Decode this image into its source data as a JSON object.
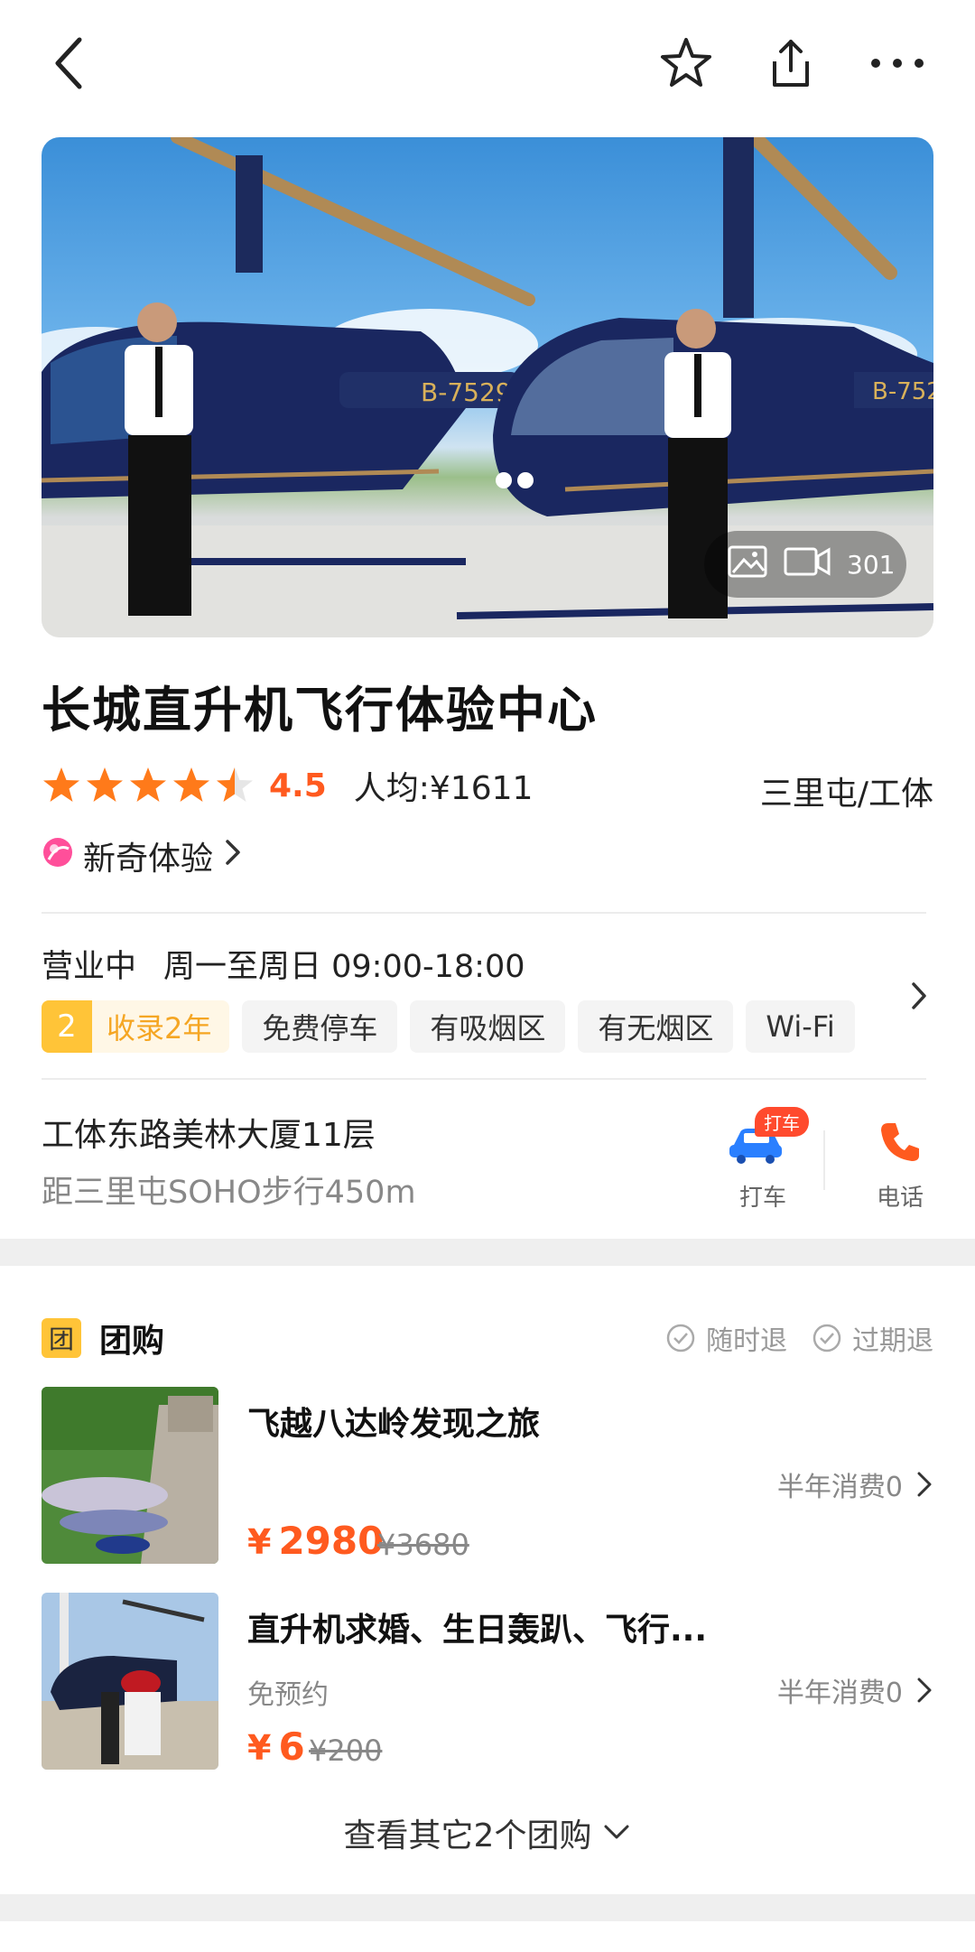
{
  "header": {
    "back_icon": "chevron-left-icon",
    "favorite_icon": "star-outline-icon",
    "share_icon": "share-icon",
    "more_icon": "more-dots-icon"
  },
  "hero": {
    "media_count": "301",
    "image_description_icons": [
      "image-icon",
      "video-icon"
    ]
  },
  "shop": {
    "name": "长城直升机飞行体验中心",
    "rating": 4.5,
    "rating_text": "4.5",
    "avg_price": "人均:¥1611",
    "area": "三里屯/工体",
    "category": "新奇体验",
    "hours_status": "营业中",
    "hours_text": "周一至周日 09:00-18:00",
    "record_years_num": "2",
    "record_years_text": "收录2年",
    "tags": [
      "免费停车",
      "有吸烟区",
      "有无烟区",
      "Wi-Fi"
    ],
    "address": "工体东路美林大厦11层",
    "distance": "距三里屯SOHO步行450m",
    "taxi_badge": "打车",
    "taxi_label": "打车",
    "phone_label": "电话"
  },
  "group_buy": {
    "badge": "团",
    "title": "团购",
    "refund_anytime": "随时退",
    "refund_expired": "过期退",
    "deals": [
      {
        "name": "飞越八达岭发现之旅",
        "sub": "",
        "consume": "半年消费0",
        "currency": "¥",
        "price": "2980",
        "original": "¥3680"
      },
      {
        "name": "直升机求婚、生日轰趴、飞行...",
        "sub": "免预约",
        "consume": "半年消费0",
        "currency": "¥",
        "price": "6",
        "original": "¥200"
      }
    ],
    "more_text": "查看其它2个团购"
  },
  "colors": {
    "accent": "#ff5a1f",
    "star": "#ff7a1a",
    "tag_yellow": "#ffc438",
    "taxi_blue": "#2a7fff",
    "phone_orange": "#ff5a1f"
  }
}
